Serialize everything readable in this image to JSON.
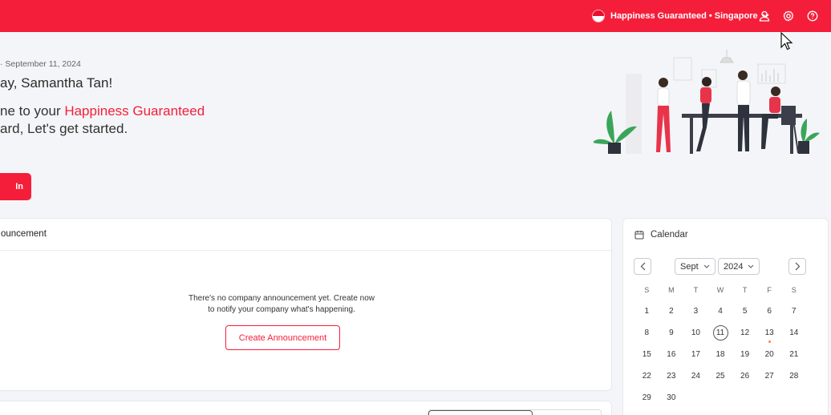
{
  "header": {
    "company_name": "Happiness Guaranteed • Singapore",
    "flag_colors": {
      "top": "#e8112d",
      "bottom": "#ffffff"
    },
    "icons": [
      "flag-icon",
      "chevron-down-icon",
      "user-icon",
      "gear-icon",
      "help-icon"
    ]
  },
  "colors": {
    "brand": "#f51e3a",
    "topbar": "#f51e3a",
    "background": "#f4f5f8"
  },
  "hero": {
    "date": "· September 11, 2024",
    "greeting": "ay, Samantha Tan!",
    "welcome_prefix": "ne to your ",
    "welcome_brand": "Happiness Guaranteed",
    "welcome_line2": "ard, Let's get started.",
    "action_label": "In"
  },
  "announcement": {
    "title": "ouncement",
    "empty_line1": "There's no company announcement yet. Create now",
    "empty_line2": "to notify your company what's happening.",
    "create_label": "Create Announcement"
  },
  "calendar": {
    "title": "Calendar",
    "month": "Sept",
    "year": "2024",
    "weekdays": [
      "S",
      "M",
      "T",
      "W",
      "T",
      "F",
      "S"
    ],
    "weeks": [
      [
        "1",
        "2",
        "3",
        "4",
        "5",
        "6",
        "7"
      ],
      [
        "8",
        "9",
        "10",
        "11",
        "12",
        "13",
        "14"
      ],
      [
        "15",
        "16",
        "17",
        "18",
        "19",
        "20",
        "21"
      ],
      [
        "22",
        "23",
        "24",
        "25",
        "26",
        "27",
        "28"
      ],
      [
        "29",
        "30",
        "",
        "",
        "",
        "",
        ""
      ]
    ],
    "today": "11",
    "event_days": [
      "13"
    ],
    "event_dot_color": "#f5894a"
  }
}
